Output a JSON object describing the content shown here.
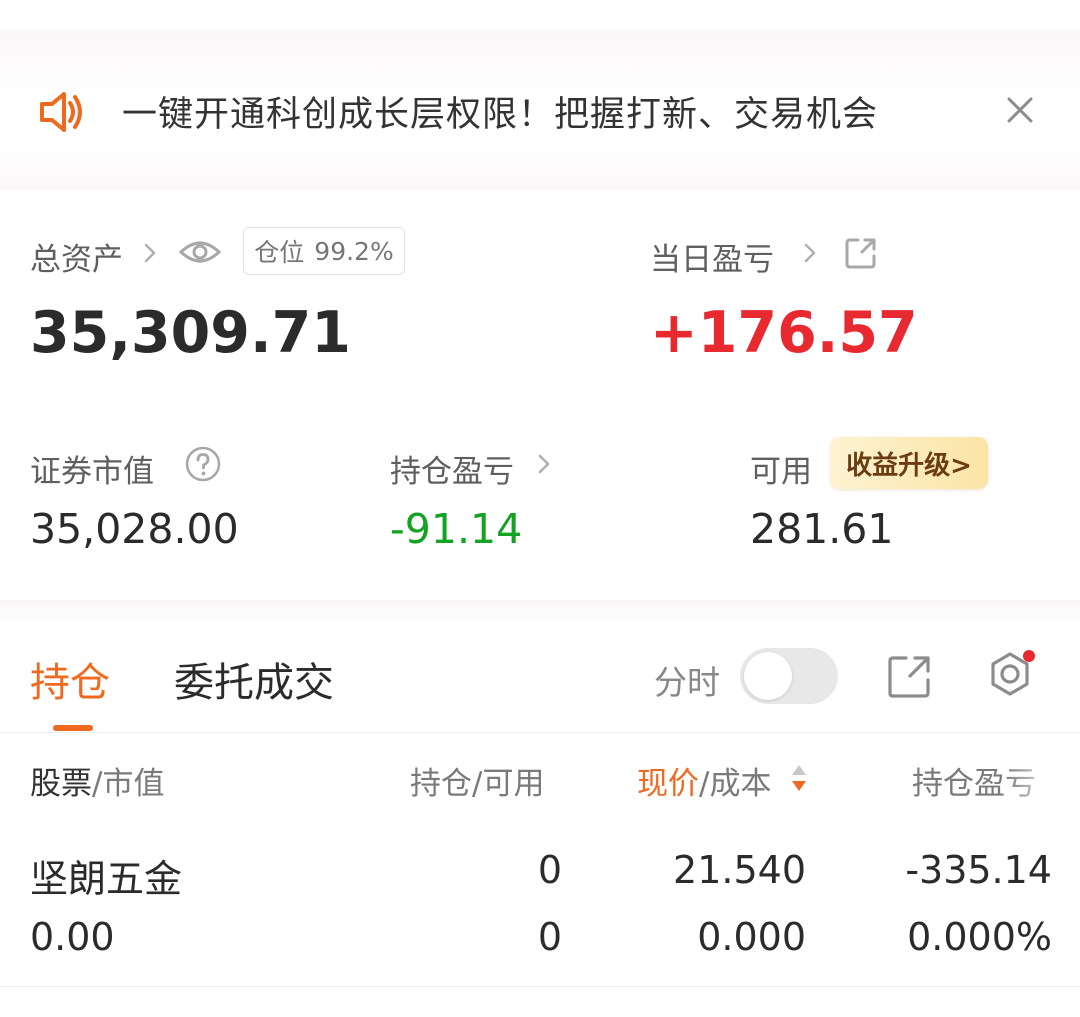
{
  "notice": {
    "text": "一键开通科创成长层权限！把握打新、交易机会",
    "icon": "speaker-icon",
    "accent": "#ef6a1f"
  },
  "summary": {
    "total_assets_label": "总资产",
    "position_label": "仓位",
    "position_value": "99.2%",
    "total_assets_value": "35,309.71",
    "daily_pnl_label": "当日盈亏",
    "daily_pnl_value": "+176.57",
    "market_value_label": "证券市值",
    "market_value_value": "35,028.00",
    "holding_pnl_label": "持仓盈亏",
    "holding_pnl_value": "-91.14",
    "available_label": "可用",
    "available_value": "281.61",
    "upgrade_label": "收益升级>"
  },
  "tabs": {
    "holdings": "持仓",
    "orders": "委托成交",
    "intraday_label": "分时"
  },
  "table": {
    "headers": {
      "stock": "股票",
      "market_value": "/市值",
      "position": "持仓/可用",
      "price": "现价",
      "cost": "/成本",
      "pnl": "持仓盈亏"
    },
    "rows": [
      {
        "name": "坚朗五金",
        "market_value": "0.00",
        "position": "0",
        "available": "0",
        "price": "21.540",
        "cost": "0.000",
        "pnl": "-335.14",
        "pnl_pct": "0.000%"
      }
    ]
  },
  "colors": {
    "red": "#e8292f",
    "green": "#13a322",
    "orange": "#ef6a1f"
  }
}
